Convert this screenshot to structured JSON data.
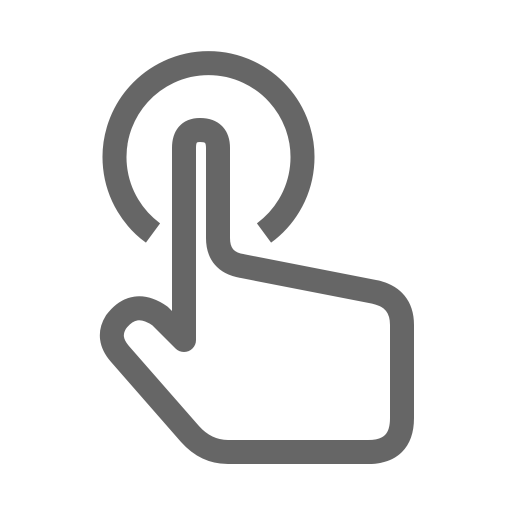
{
  "icon": {
    "name": "tap-gesture-icon",
    "parts": [
      "tap-ring",
      "pointing-hand"
    ],
    "colors": {
      "stroke": "#666666",
      "fill": "#ffffff",
      "background": "#ffffff"
    }
  }
}
